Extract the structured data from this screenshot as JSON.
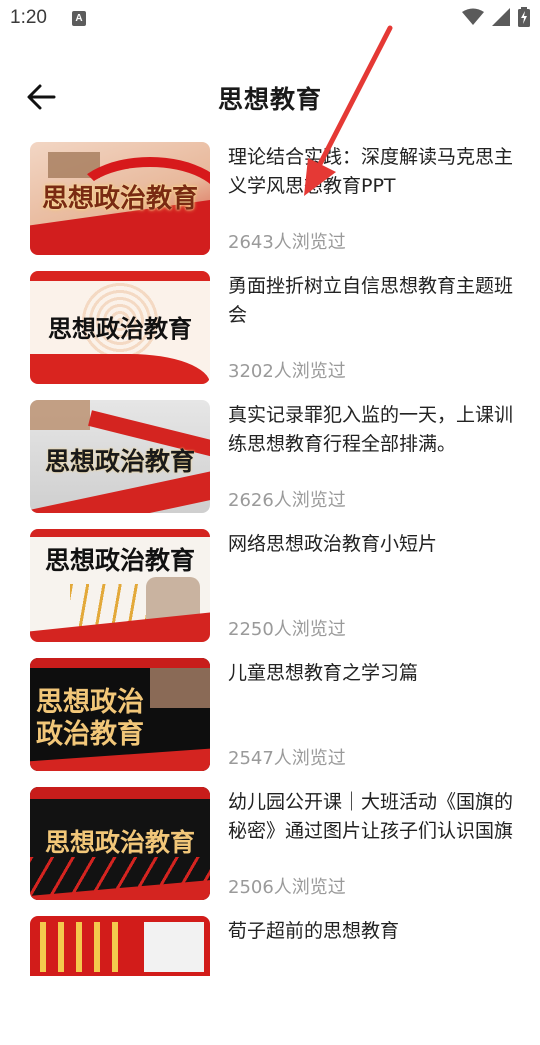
{
  "status": {
    "time": "1:20",
    "notification_icon": "a-notification-icon",
    "wifi_icon": "wifi-icon",
    "signal_icon": "signal-icon",
    "battery_icon": "battery-charging-icon"
  },
  "header": {
    "back_icon": "arrow-left-icon",
    "title": "思想教育"
  },
  "thumb_caption": "思想政治教育",
  "items": [
    {
      "title": "理论结合实践：深度解读马克思主义学风思想教育PPT",
      "views": "2643人浏览过"
    },
    {
      "title": "勇面挫折树立自信思想教育主题班会",
      "views": "3202人浏览过"
    },
    {
      "title": "真实记录罪犯入监的一天，上课训练思想教育行程全部排满。",
      "views": "2626人浏览过"
    },
    {
      "title": "网络思想政治教育小短片",
      "views": "2250人浏览过"
    },
    {
      "title": "儿童思想教育之学习篇",
      "views": "2547人浏览过",
      "thumb_lines": [
        "思想政治",
        "政治教育"
      ]
    },
    {
      "title": "幼儿园公开课｜大班活动《国旗的秘密》通过图片让孩子们认识国旗",
      "views": "2506人浏览过"
    },
    {
      "title": "荀子超前的思想教育",
      "views": ""
    }
  ],
  "colors": {
    "accent_red": "#d8201f",
    "gold": "#e8c36a",
    "annotation_arrow": "#e53935"
  }
}
